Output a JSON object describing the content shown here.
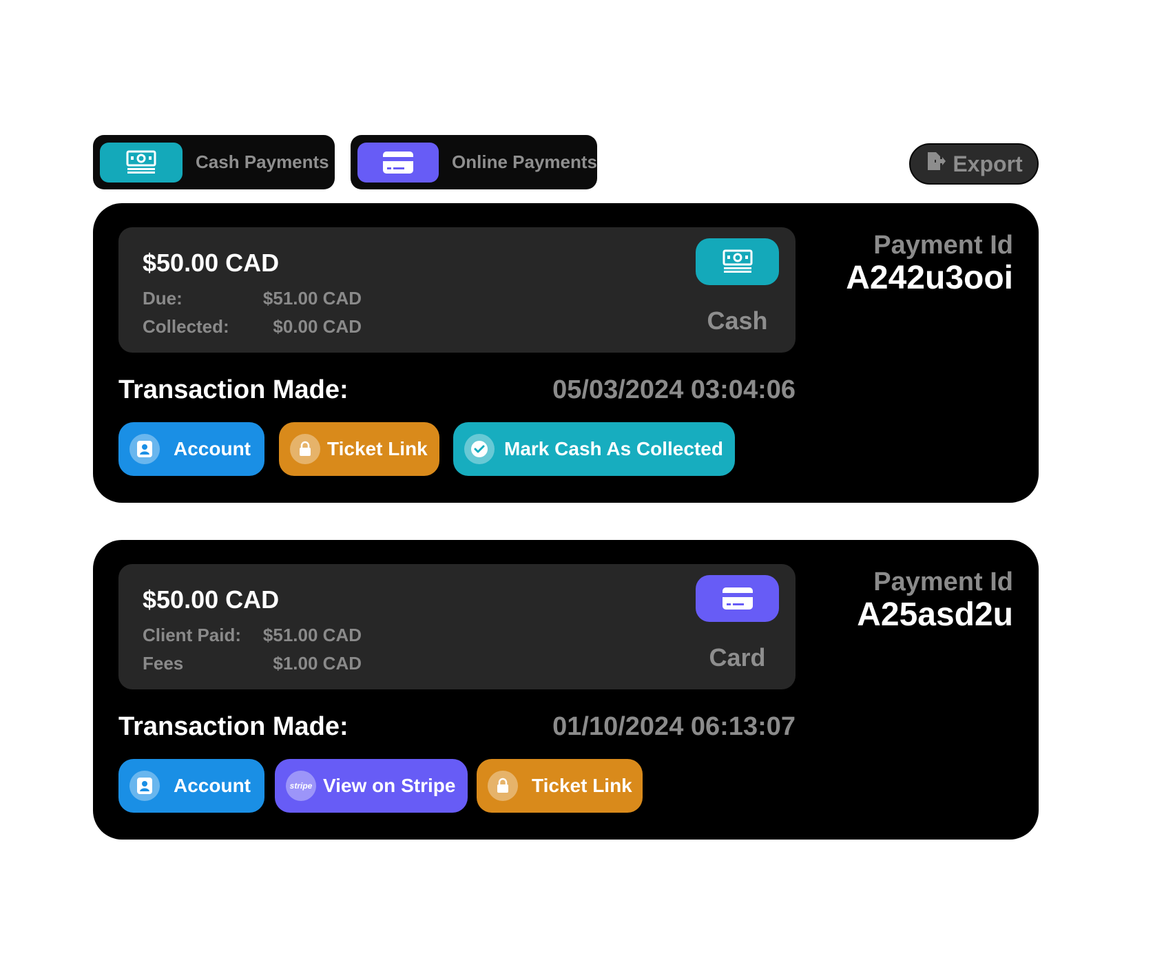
{
  "filters": {
    "cash": {
      "label": "Cash Payments",
      "icon": "cash-icon",
      "color": "#14a9ba"
    },
    "online": {
      "label": "Online Payments",
      "icon": "credit-card-icon",
      "color": "#675cf6"
    }
  },
  "export": {
    "label": "Export",
    "icon": "export-icon"
  },
  "payments": [
    {
      "amount": "$50.00 CAD",
      "details": [
        {
          "label": "Due:",
          "value": "$51.00 CAD"
        },
        {
          "label": "Collected:",
          "value": "$0.00 CAD"
        }
      ],
      "method": {
        "label": "Cash",
        "icon": "cash-icon",
        "color": "#14a9ba"
      },
      "payment_id_label": "Payment Id",
      "payment_id": "A242u3ooi",
      "transaction_label": "Transaction Made:",
      "transaction_date": "05/03/2024 03:04:06",
      "actions": [
        {
          "label": "Account",
          "icon": "account-icon",
          "color": "#1a8fe5"
        },
        {
          "label": "Ticket Link",
          "icon": "lock-icon",
          "color": "#d98a1b"
        },
        {
          "label": "Mark Cash As Collected",
          "icon": "check-circle-icon",
          "color": "#17adbf"
        }
      ]
    },
    {
      "amount": "$50.00 CAD",
      "details": [
        {
          "label": "Client Paid:",
          "value": "$51.00 CAD"
        },
        {
          "label": "Fees",
          "value": "$1.00 CAD"
        }
      ],
      "method": {
        "label": "Card",
        "icon": "credit-card-icon",
        "color": "#675cf6"
      },
      "payment_id_label": "Payment Id",
      "payment_id": "A25asd2u",
      "transaction_label": "Transaction Made:",
      "transaction_date": "01/10/2024 06:13:07",
      "actions": [
        {
          "label": "Account",
          "icon": "account-icon",
          "color": "#1a8fe5"
        },
        {
          "label": "View on Stripe",
          "icon": "stripe-icon",
          "icon_text": "stripe",
          "color": "#675cf6"
        },
        {
          "label": "Ticket Link",
          "icon": "lock-icon",
          "color": "#d98a1b"
        }
      ]
    }
  ]
}
